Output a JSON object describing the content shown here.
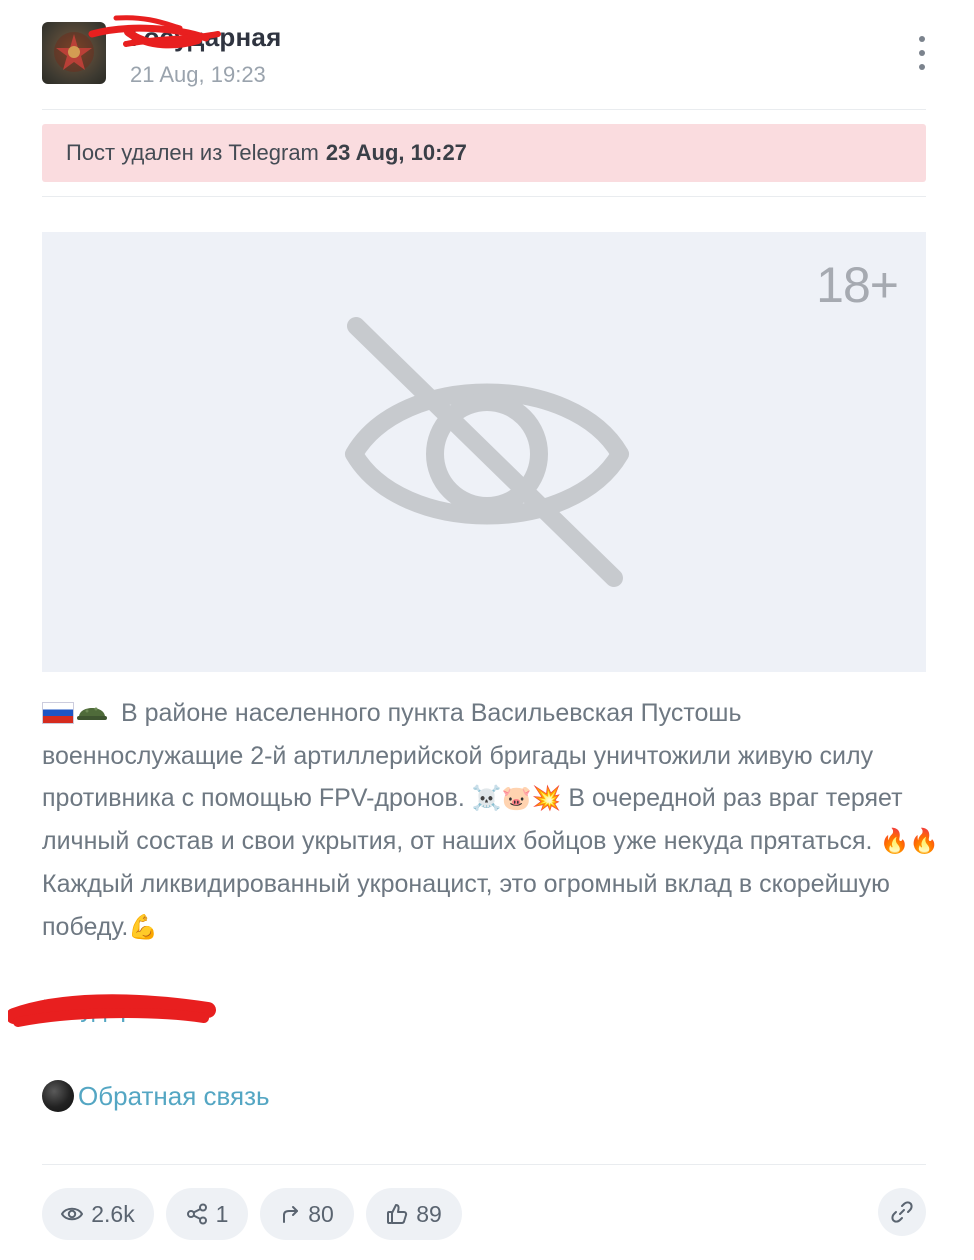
{
  "header": {
    "channel_name": "Государная",
    "post_time": "21 Aug, 19:23",
    "menu_icon": "kebab-menu-icon"
  },
  "banner": {
    "text": "Пост удален из Telegram",
    "date": "23 Aug, 10:27",
    "color": "#fadcdf"
  },
  "media": {
    "age_label": "18+",
    "icon": "eye-off-icon"
  },
  "post": {
    "text_1": "В районе населенного пункта Васильевская Пустошь военнослужащие 2-й артиллерийской бригады уничтожили живую силу противника с помощью FPV-дронов.",
    "emoji_1": "☠️🐷💥",
    "text_2": "В очередной раз враг теряет личный состав и свои укрытия, от наших бойцов уже некуда прятаться.",
    "emoji_2": "🔥🔥",
    "text_3": "Каждый ликвидированный укронацист, это огромный вклад в скорейшую победу.",
    "emoji_3": "💪"
  },
  "links": {
    "channel": "Государная",
    "feedback": "Обратная связь"
  },
  "stats": {
    "views": "2.6k",
    "shares": "1",
    "forwards": "80",
    "likes": "89"
  },
  "colors": {
    "link": "#54a6c3",
    "text": "#6e7882",
    "pill_bg": "#eef1f5",
    "media_bg": "#eef1f7"
  }
}
